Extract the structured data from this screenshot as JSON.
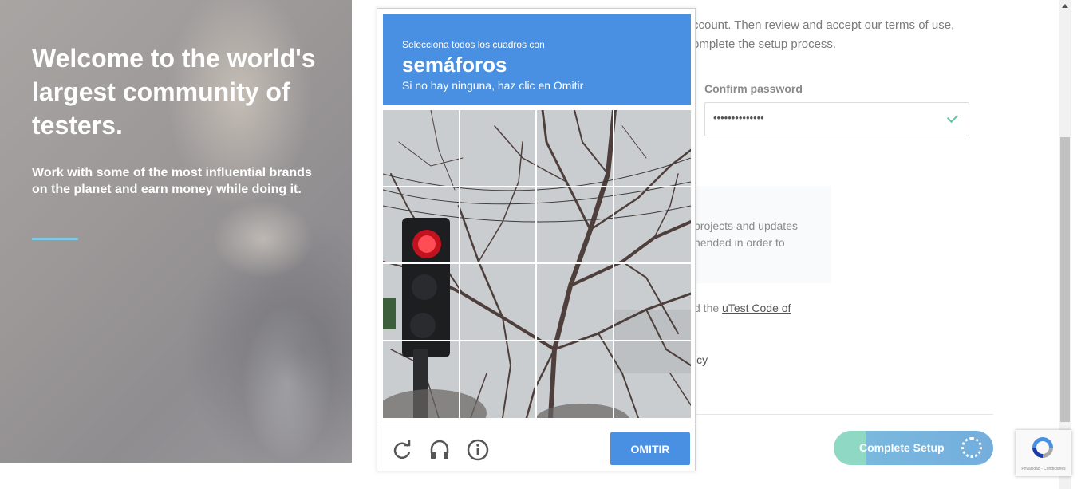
{
  "hero": {
    "title": "Welcome to the world's largest community of testers.",
    "subtitle": "Work with some of the most influential brands on the planet and earn money while doing it."
  },
  "form": {
    "intro_line1": "ccount. Then review and accept our terms of use,",
    "intro_line2": "omplete the setup process.",
    "confirm_password_label": "Confirm password",
    "confirm_password_value": "••••••••••••••",
    "info_line1": "projects and updates",
    "info_line2": "nended in order to",
    "code_prefix": "d the ",
    "code_link": "uTest Code of",
    "policy_link": "icy",
    "complete_button": "Complete Setup"
  },
  "captcha": {
    "instruction": "Selecciona todos los cuadros con",
    "target": "semáforos",
    "skip_hint": "Si no hay ninguna, haz clic en Omitir",
    "skip_button": "OMITIR",
    "tools": [
      "reload-icon",
      "audio-icon",
      "info-icon"
    ],
    "grid_rows": 4,
    "grid_cols": 4
  },
  "badge": {
    "text": "Privacidad - Condiciones"
  },
  "colors": {
    "captcha_blue": "#4a90e2",
    "accent_green": "#8fd8c3",
    "accent_blue": "#7ab8dd",
    "hero_line": "#7fcbe6"
  }
}
